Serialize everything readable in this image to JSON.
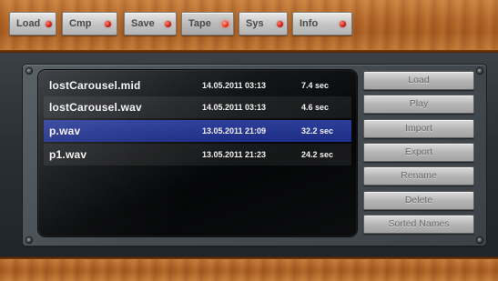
{
  "toolbar": {
    "tabs": [
      {
        "label": "Load",
        "active": false
      },
      {
        "label": "Cmp",
        "active": false
      },
      {
        "label": "Save",
        "active": false
      },
      {
        "label": "Tape",
        "active": true
      },
      {
        "label": "Sys",
        "active": false
      },
      {
        "label": "Info",
        "active": false
      }
    ],
    "led_color": "#d51e10"
  },
  "files": [
    {
      "name": "lostCarousel.mid",
      "date": "14.05.2011 03:13",
      "duration": "7.4 sec",
      "selected": false
    },
    {
      "name": "lostCarousel.wav",
      "date": "14.05.2011 03:13",
      "duration": "4.6 sec",
      "selected": false
    },
    {
      "name": "p.wav",
      "date": "13.05.2011 21:09",
      "duration": "32.2 sec",
      "selected": true
    },
    {
      "name": "p1.wav",
      "date": "13.05.2011 21:23",
      "duration": "24.2 sec",
      "selected": false
    }
  ],
  "actions": {
    "load": "Load",
    "play": "Play",
    "import": "Import",
    "export": "Export",
    "rename": "Rename",
    "delete": "Delete",
    "sorted_names": "Sorted Names"
  },
  "colors": {
    "selection": "#23338c",
    "wood": "#b4682a"
  }
}
